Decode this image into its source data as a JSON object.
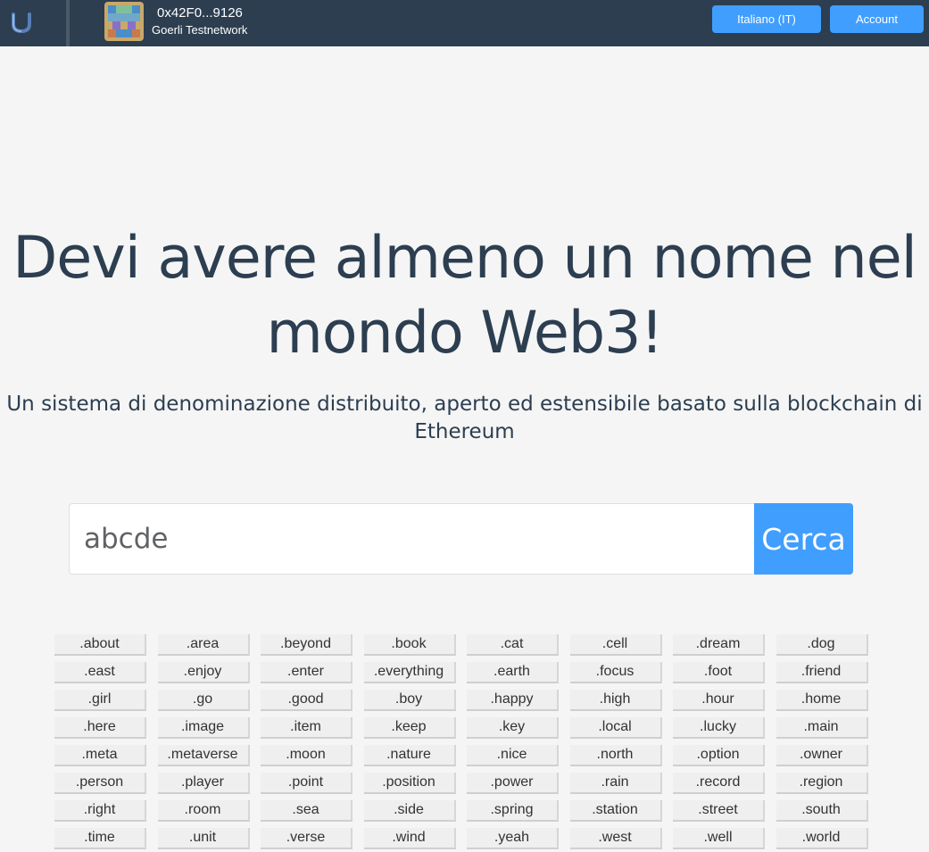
{
  "header": {
    "logo_icon": "ulogo-icon",
    "account_address": "0x42F0...9126",
    "network": "Goerli Testnetwork",
    "language_button": "Italiano (IT)",
    "account_button": "Account"
  },
  "hero": {
    "title_line1": "Devi avere almeno un nome nel",
    "title_line2": "mondo Web3!",
    "subtitle_line1": "Un sistema di denominazione distribuito, aperto ed estensibile basato sulla blockchain di",
    "subtitle_line2": "Ethereum"
  },
  "search": {
    "value": "abcde",
    "button": "Cerca"
  },
  "tlds": [
    ".about",
    ".area",
    ".beyond",
    ".book",
    ".cat",
    ".cell",
    ".dream",
    ".dog",
    ".east",
    ".enjoy",
    ".enter",
    ".everything",
    ".earth",
    ".focus",
    ".foot",
    ".friend",
    ".girl",
    ".go",
    ".good",
    ".boy",
    ".happy",
    ".high",
    ".hour",
    ".home",
    ".here",
    ".image",
    ".item",
    ".keep",
    ".key",
    ".local",
    ".lucky",
    ".main",
    ".meta",
    ".metaverse",
    ".moon",
    ".nature",
    ".nice",
    ".north",
    ".option",
    ".owner",
    ".person",
    ".player",
    ".point",
    ".position",
    ".power",
    ".rain",
    ".record",
    ".region",
    ".right",
    ".room",
    ".sea",
    ".side",
    ".spring",
    ".station",
    ".street",
    ".south",
    ".time",
    ".unit",
    ".verse",
    ".wind",
    ".yeah",
    ".west",
    ".well",
    ".world"
  ],
  "colors": {
    "topbar": "#2c3e50",
    "accent": "#409eff",
    "text": "#2c3e50"
  }
}
